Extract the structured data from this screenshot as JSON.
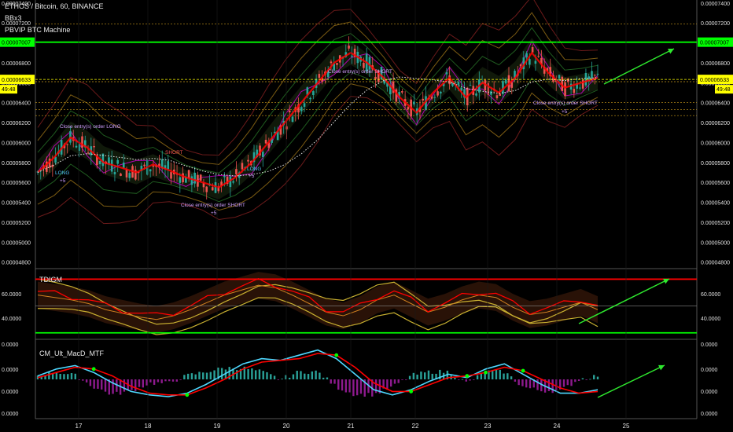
{
  "header": {
    "symbol_line": "ETHOS / Bitcoin, 60, BINANCE",
    "indicator_1": "BBx3",
    "indicator_2": "PBVIP BTC Machine"
  },
  "panes": {
    "rsi_title": "TDIGM",
    "macd_title": "CM_Ult_MacD_MTF"
  },
  "price_tags": {
    "green_level": "0.00007007",
    "last_price": "0.00006633",
    "countdown": "49:48"
  },
  "annotations": {
    "close_long": "Close entry(s) order LONG",
    "close_short_1": "Close entry(s) order SHORT",
    "close_short_2": "Close entry(s) order SHORT",
    "close_short_3": "Close entry(s) order SHORT",
    "short_label": "SHORT",
    "long_label_1": "LONG",
    "long_label_2": "LONG",
    "plus5_a": "+5",
    "plus5_b": "+5",
    "plus5_c": "+5",
    "plus5_d": "+5"
  },
  "colors": {
    "background": "#000000",
    "up_candle": "#26a69a",
    "down_candle": "#ef5350",
    "green_line": "#00ff00",
    "red_line": "#ff0000",
    "arrow": "#2ee82e",
    "price_tag_bg": "#ffff00",
    "magenta": "#b000b0"
  },
  "chart_data": [
    {
      "type": "candlestick",
      "title": "ETHOS / Bitcoin, 60, BINANCE",
      "y_ticks": [
        "0.00007400",
        "0.00007200",
        "0.00007000",
        "0.00006800",
        "0.00006600",
        "0.00006400",
        "0.00006200",
        "0.00006000",
        "0.00005800",
        "0.00005600",
        "0.00005400",
        "0.00005200",
        "0.00005000",
        "0.00004800"
      ],
      "ylim": [
        4.75e-05,
        7.43e-05
      ],
      "x_ticks": [
        "17",
        "18",
        "19",
        "20",
        "21",
        "22",
        "23",
        "24",
        "25"
      ],
      "horizontal_levels": {
        "green": 7.007e-05,
        "last_price": 6.633e-05
      },
      "close_path": [
        5.7e-05,
        5.85e-05,
        6.05e-05,
        5.95e-05,
        5.8e-05,
        5.75e-05,
        5.7e-05,
        5.78e-05,
        5.72e-05,
        5.65e-05,
        5.6e-05,
        5.55e-05,
        5.65e-05,
        5.8e-05,
        6e-05,
        6.2e-05,
        6.4e-05,
        6.6e-05,
        6.8e-05,
        6.9e-05,
        6.8e-05,
        6.65e-05,
        6.45e-05,
        6.3e-05,
        6.5e-05,
        6.65e-05,
        6.45e-05,
        6.6e-05,
        6.5e-05,
        6.65e-05,
        6.9e-05,
        6.7e-05,
        6.55e-05,
        6.6e-05,
        6.65e-05
      ]
    },
    {
      "type": "line",
      "title": "TDIGM",
      "y_ticks": [
        "60.0000",
        "40.0000"
      ],
      "ylim": [
        24,
        80
      ],
      "levels": {
        "red": 72,
        "green": 28
      },
      "series": [
        {
          "values": [
            62,
            60,
            58,
            55,
            50,
            47,
            44,
            42,
            45,
            50,
            56,
            62,
            66,
            70,
            68,
            62,
            55,
            48,
            45,
            50,
            58,
            62,
            55,
            48,
            52,
            58,
            62,
            60,
            52,
            46,
            48,
            52,
            56,
            50
          ]
        }
      ]
    },
    {
      "type": "line",
      "title": "CM_Ult_MacD_MTF",
      "y_ticks": [
        "0.0000",
        "0.0000",
        "0.0000",
        "0.0000",
        "0.0000"
      ],
      "series": [
        {
          "values": [
            0.2,
            0.6,
            0.8,
            0.4,
            -0.2,
            -0.7,
            -0.9,
            -1.0,
            -0.8,
            -0.3,
            0.3,
            0.9,
            1.2,
            1.1,
            1.4,
            1.7,
            1.2,
            0.3,
            -0.6,
            -0.9,
            -0.6,
            -0.1,
            0.3,
            0.1,
            0.6,
            0.9,
            0.3,
            -0.3,
            -0.8,
            -0.8,
            -0.6
          ]
        },
        {
          "values": [
            0.1,
            0.4,
            0.7,
            0.6,
            0.2,
            -0.4,
            -0.8,
            -0.9,
            -0.9,
            -0.5,
            0.0,
            0.6,
            1.0,
            1.1,
            1.2,
            1.5,
            1.4,
            0.7,
            -0.2,
            -0.7,
            -0.7,
            -0.3,
            0.1,
            0.2,
            0.4,
            0.7,
            0.5,
            0.0,
            -0.5,
            -0.8,
            -0.7
          ]
        }
      ]
    }
  ]
}
